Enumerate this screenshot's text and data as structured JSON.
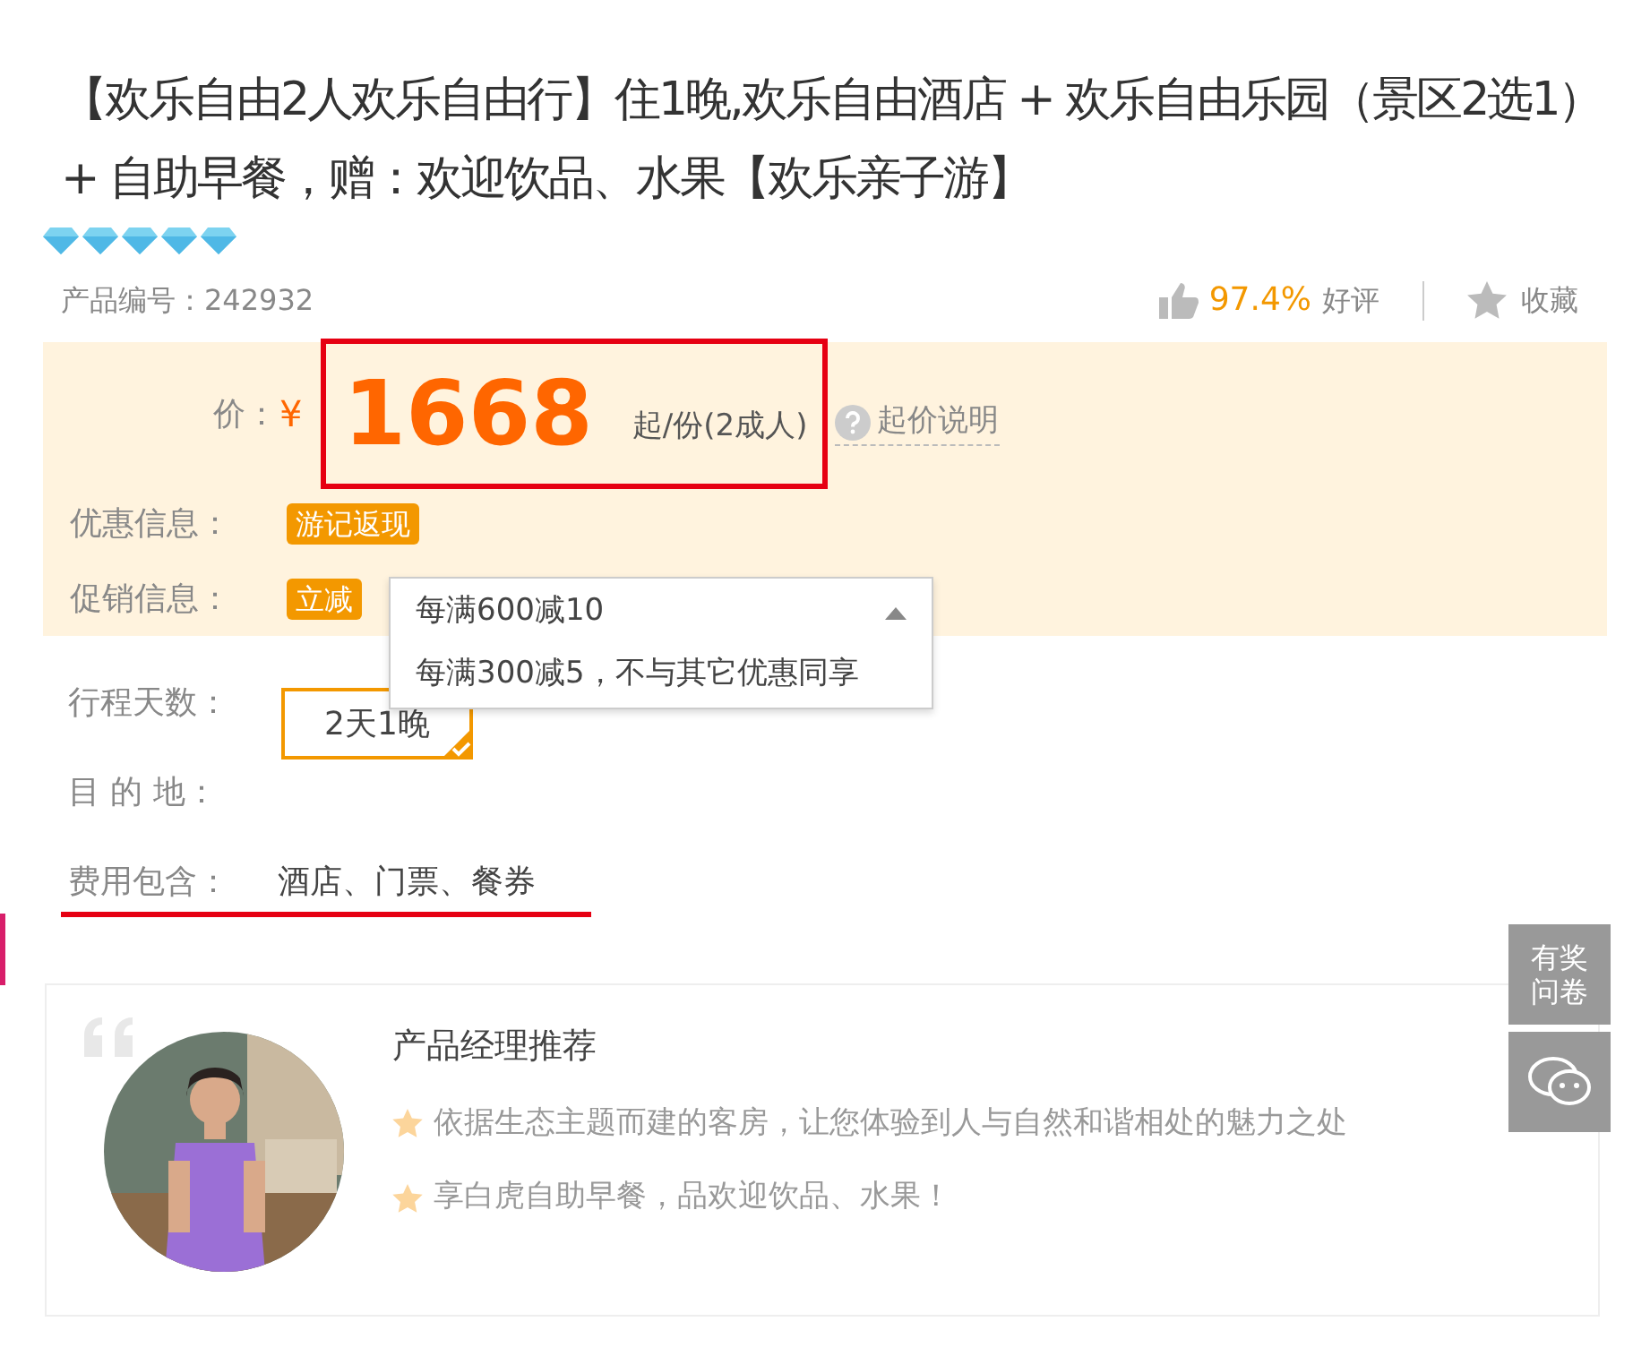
{
  "product": {
    "title": "【欢乐自由2人欢乐自由行】住1晚,欢乐自由酒店 + 欢乐自由乐园（景区2选1） + 自助早餐，赠：欢迎饮品、水果【欢乐亲子游】",
    "stars": 5,
    "code": "产品编号：242932",
    "rating_value": "97.4%",
    "rating_label": "好评",
    "favorite": "收藏"
  },
  "price": {
    "label": "价：",
    "currency": "¥",
    "amount": "1668",
    "unit": "起/份(2成人)",
    "help": "起价说明"
  },
  "offers": [
    {
      "label": "优惠信息：",
      "tag": "游记返现"
    },
    {
      "label": "促销信息：",
      "tag": "立减",
      "dropdown": {
        "expanded": true,
        "value": "每满600减10",
        "options": [
          "每满300减5，不与其它优惠同享"
        ]
      }
    }
  ],
  "details": [
    {
      "kind": "select",
      "label": "行程天数：",
      "value": "2天1晚",
      "selected": true
    },
    {
      "kind": "text",
      "label": "目 的 地："
    },
    {
      "kind": "text",
      "label": "费用包含：",
      "value": "酒店、门票、餐券"
    }
  ],
  "recommend": {
    "title": "产品经理推荐",
    "points": [
      "依据生态主题而建的客房，让您体验到人与自然和谐相处的魅力之处",
      "享白虎自助早餐，品欢迎饮品、水果！"
    ]
  },
  "side": {
    "survey": "有奖问卷"
  }
}
